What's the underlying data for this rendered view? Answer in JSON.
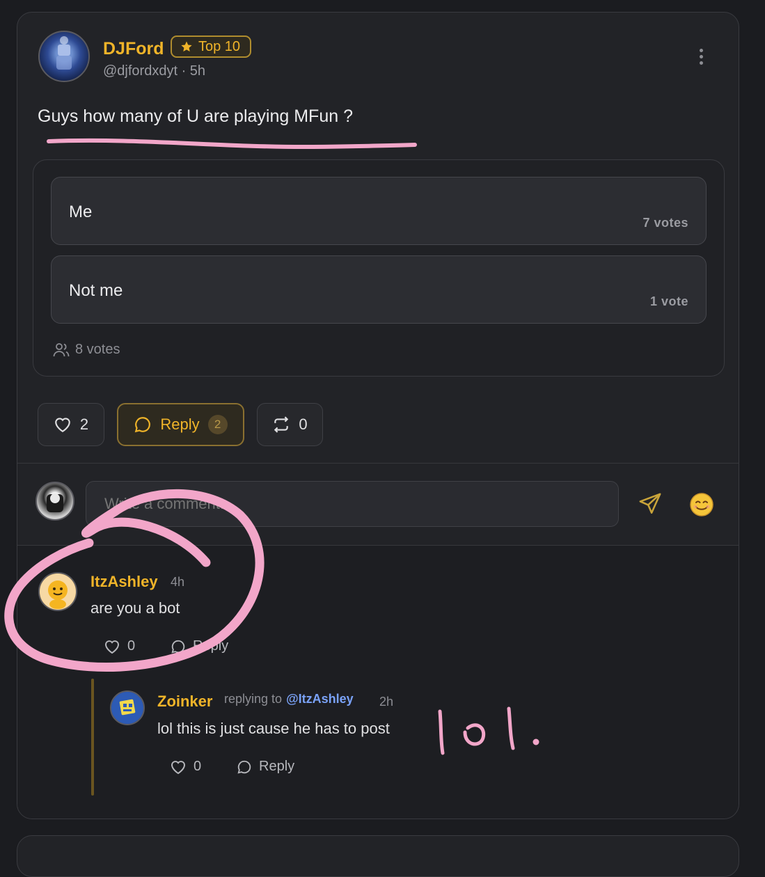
{
  "post": {
    "author": "DJFord",
    "badge": "Top 10",
    "handle": "@djfordxdyt · 5h",
    "text": "Guys how many of U are playing MFun ?",
    "poll": {
      "options": [
        {
          "label": "Me",
          "votes": "7 votes"
        },
        {
          "label": "Not me",
          "votes": "1 vote"
        }
      ],
      "total": "8 votes"
    },
    "actions": {
      "likes": "2",
      "reply_label": "Reply",
      "reply_count": "2",
      "reposts": "0"
    }
  },
  "composer": {
    "placeholder": "Write a comment...",
    "icons": {
      "send": "send-icon",
      "emoji": "emoji-icon"
    }
  },
  "comments": [
    {
      "author": "ItzAshley",
      "time": "4h",
      "text": "are you a bot",
      "likes": "0",
      "reply_label": "Reply"
    }
  ],
  "replies": [
    {
      "author": "Zoinker",
      "replying_prefix": "replying to",
      "replying_to": "@ItzAshley",
      "time": "2h",
      "text": "lol this is just cause he has to post",
      "likes": "0",
      "reply_label": "Reply"
    }
  ],
  "annotation": {
    "handwriting": "lol.",
    "color": "#f2a6c9"
  },
  "colors": {
    "accent": "#f0b429",
    "background": "#1b1c20",
    "card": "#222327",
    "mention": "#7aa2f7"
  }
}
